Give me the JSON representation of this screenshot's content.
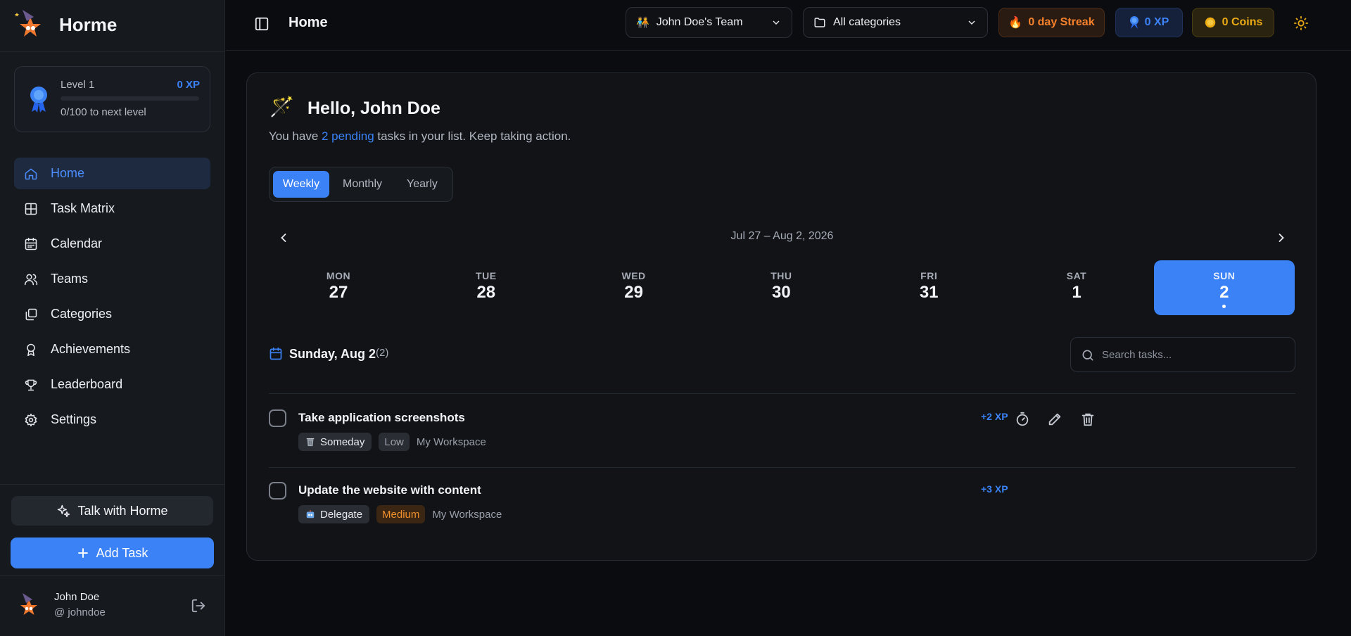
{
  "app": {
    "name": "Horme"
  },
  "level": {
    "title": "Level 1",
    "xp": "0 XP",
    "next": "0/100 to next level",
    "progress": 0
  },
  "nav": [
    {
      "label": "Home",
      "icon": "home-icon",
      "active": true
    },
    {
      "label": "Task Matrix",
      "icon": "grid-icon"
    },
    {
      "label": "Calendar",
      "icon": "calendar-icon"
    },
    {
      "label": "Teams",
      "icon": "users-icon"
    },
    {
      "label": "Categories",
      "icon": "categories-icon"
    },
    {
      "label": "Achievements",
      "icon": "award-icon"
    },
    {
      "label": "Leaderboard",
      "icon": "trophy-icon"
    },
    {
      "label": "Settings",
      "icon": "gear-icon"
    }
  ],
  "actions": {
    "talk": "Talk with Horme",
    "add_task": "Add Task"
  },
  "user": {
    "name": "John Doe",
    "handle": "@ johndoe"
  },
  "header": {
    "title": "Home",
    "team": "John Doe's Team",
    "category": "All categories",
    "streak": "0 day Streak",
    "xp": "0 XP",
    "coins": "0 Coins"
  },
  "main": {
    "greeting": "Hello, John Doe",
    "subtitle_pre": "You have ",
    "subtitle_hl": "2 pending",
    "subtitle_post": " tasks in your list. Keep taking action.",
    "tabs": [
      {
        "label": "Weekly",
        "active": true
      },
      {
        "label": "Monthly"
      },
      {
        "label": "Yearly"
      }
    ],
    "week_range": "Jul 27 – Aug 2, 2026",
    "days": [
      {
        "name": "MON",
        "num": "27"
      },
      {
        "name": "TUE",
        "num": "28"
      },
      {
        "name": "WED",
        "num": "29"
      },
      {
        "name": "THU",
        "num": "30"
      },
      {
        "name": "FRI",
        "num": "31"
      },
      {
        "name": "SAT",
        "num": "1"
      },
      {
        "name": "SUN",
        "num": "2",
        "active": true
      }
    ],
    "selected_date": "Sunday, Aug 2",
    "task_count": "(2)",
    "search_placeholder": "Search tasks...",
    "tasks": [
      {
        "title": "Take application screenshots",
        "matrix": "Someday",
        "matrix_icon": "wastebasket-icon",
        "priority": "Low",
        "workspace": "My Workspace",
        "xp": "+2 XP"
      },
      {
        "title": "Update the website with content",
        "matrix": "Delegate",
        "matrix_icon": "robot-icon",
        "priority": "Medium",
        "workspace": "My Workspace",
        "xp": "+3 XP"
      }
    ]
  },
  "colors": {
    "accent": "#3b82f6",
    "streak": "#f5802b",
    "coins": "#eaaa14",
    "medium": "#f0902e"
  }
}
